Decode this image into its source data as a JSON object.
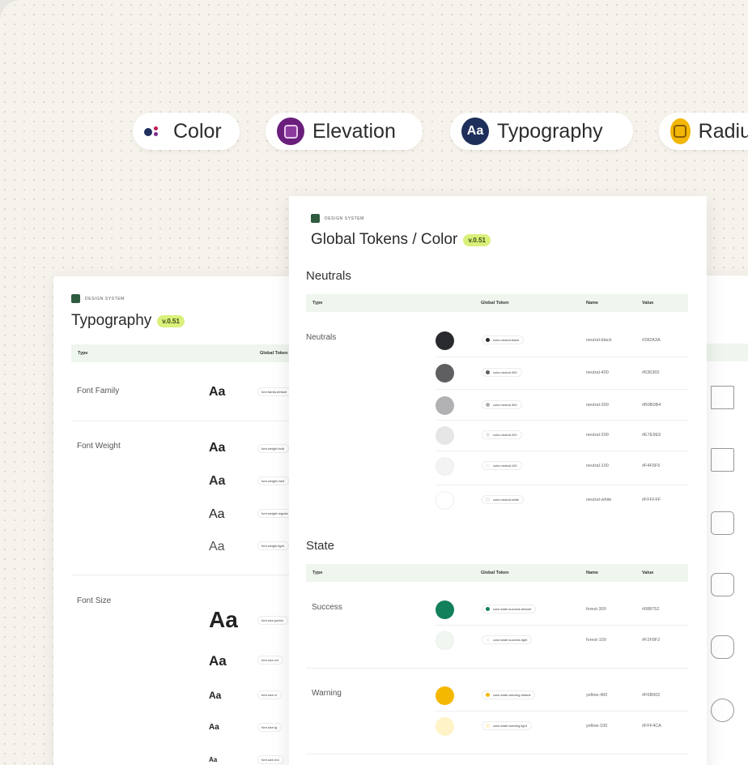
{
  "pills": {
    "color": "Color",
    "elevation": "Elevation",
    "typography": "Typography",
    "typography_icon": "Aa",
    "radius": "Radiu"
  },
  "colors": {
    "background": "#f6f3ec",
    "header_row": "#eef6ee",
    "version_badge": "#d9f07a",
    "brand_logo": "#2f5a3f"
  },
  "icons": {
    "color_pill": "palette-dots-icon",
    "elevation_pill": "layers-icon",
    "typography_pill": "aa-text-icon",
    "radius_pill": "rounded-square-icon",
    "logo": "design-system-logo-icon"
  },
  "color_sheet": {
    "ds_label": "DESIGN SYSTEM",
    "title": "Global Tokens / Color",
    "version": "v.0.51",
    "neutrals": {
      "heading": "Neutrals",
      "columns": [
        "Type",
        "Global Token",
        "Name",
        "Value"
      ],
      "type_label": "Neutrals",
      "rows": [
        {
          "token": "color.neutral.black",
          "name": "neutral-black",
          "value": "#282A3A",
          "swatch": "#282a2e"
        },
        {
          "token": "color.neutral.400",
          "name": "neutral-400",
          "value": "#636365",
          "swatch": "#5f5f61"
        },
        {
          "token": "color.neutral.300",
          "name": "neutral-300",
          "value": "#B0B0B4",
          "swatch": "#b1b1b3"
        },
        {
          "token": "color.neutral.200",
          "name": "neutral-200",
          "value": "#E7E9E9",
          "swatch": "#e6e6e6"
        },
        {
          "token": "color.neutral.100",
          "name": "neutral-100",
          "value": "#F4F5F5",
          "swatch": "#f3f3f3"
        },
        {
          "token": "color.neutral.white",
          "name": "neutral-white",
          "value": "#FFFFFF",
          "swatch": "#ffffff"
        }
      ]
    },
    "state": {
      "heading": "State",
      "columns": [
        "Type",
        "Global Token",
        "Name",
        "Value"
      ],
      "success_label": "Success",
      "warning_label": "Warning",
      "rows": [
        {
          "token": "color.state.success.default",
          "name": "forest-300",
          "value": "#088752",
          "swatch": "#12805a"
        },
        {
          "token": "color.state.success.light",
          "name": "forest-100",
          "value": "#F2F8F2",
          "swatch": "#f0f7f1"
        },
        {
          "token": "color.state.warning.default",
          "name": "yellow-400",
          "value": "#F6B902",
          "swatch": "#f5b800"
        },
        {
          "token": "color.state.warning.light",
          "name": "yellow-100",
          "value": "#FFF4CA",
          "swatch": "#fff3c7"
        }
      ]
    }
  },
  "typography_sheet": {
    "ds_label": "DESIGN SYSTEM",
    "title": "Typography",
    "version": "v.0.51",
    "columns": [
      "Type",
      "Global Token"
    ],
    "sample": "Aa",
    "font_family_label": "Font Family",
    "font_weight_label": "Font Weight",
    "font_size_label": "Font Size",
    "family_tokens": [
      "font.family.default"
    ],
    "weight_tokens": [
      "font.weight.bold",
      "font.weight.med",
      "font.weight.regular",
      "font.weight.light"
    ],
    "size_tokens": [
      "font.size.jumbo",
      "font.size.xxl",
      "font.size.xl",
      "font.size.lg",
      "font.size.md"
    ]
  }
}
